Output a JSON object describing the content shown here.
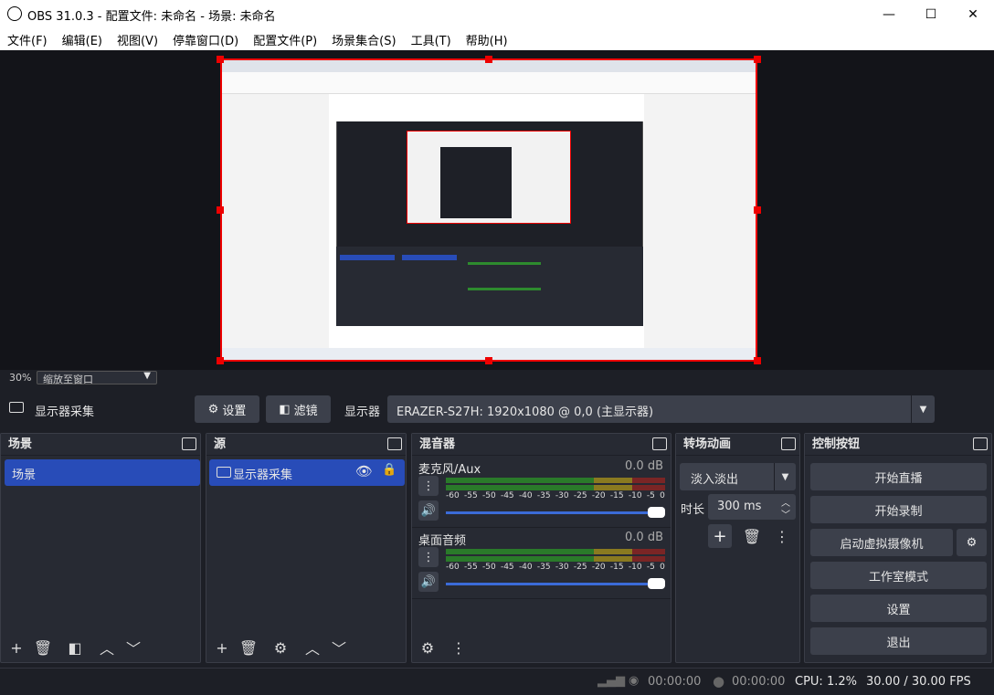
{
  "window": {
    "title": "OBS 31.0.3 - 配置文件: 未命名 - 场景: 未命名",
    "min": "—",
    "max": "☐",
    "close": "✕"
  },
  "menu": [
    "文件(F)",
    "编辑(E)",
    "视图(V)",
    "停靠窗口(D)",
    "配置文件(P)",
    "场景集合(S)",
    "工具(T)",
    "帮助(H)"
  ],
  "zoom": {
    "percent": "30%",
    "mode": "缩放至窗口"
  },
  "source_bar": {
    "name": "显示器采集",
    "settings": "设置",
    "filters": "滤镜",
    "display_label": "显示器",
    "display_value": "ERAZER-S27H: 1920x1080 @ 0,0 (主显示器)"
  },
  "docks": {
    "scenes": {
      "title": "场景",
      "items": [
        "场景"
      ]
    },
    "sources": {
      "title": "源",
      "items": [
        "显示器采集"
      ]
    },
    "mixer": {
      "title": "混音器",
      "channels": [
        {
          "name": "麦克风/Aux",
          "db": "0.0 dB"
        },
        {
          "name": "桌面音频",
          "db": "0.0 dB"
        }
      ],
      "scale": [
        "-60",
        "-55",
        "-50",
        "-45",
        "-40",
        "-35",
        "-30",
        "-25",
        "-20",
        "-15",
        "-10",
        "-5",
        "0"
      ]
    },
    "transitions": {
      "title": "转场动画",
      "type": "淡入淡出",
      "duration_label": "时长",
      "duration": "300 ms"
    },
    "controls": {
      "title": "控制按钮",
      "buttons": [
        "开始直播",
        "开始录制",
        "启动虚拟摄像机",
        "工作室模式",
        "设置",
        "退出"
      ]
    }
  },
  "status": {
    "live_time": "00:00:00",
    "rec_time": "00:00:00",
    "cpu": "CPU: 1.2%",
    "fps": "30.00 / 30.00 FPS"
  }
}
